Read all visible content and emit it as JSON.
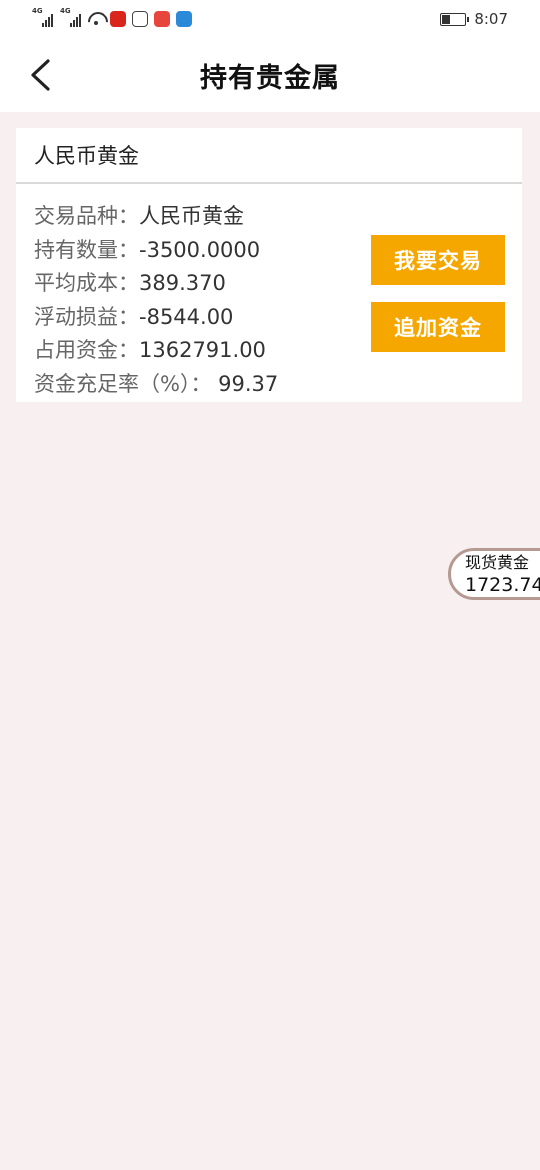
{
  "status_bar": {
    "signal1_tag": "4G",
    "signal2_tag": "4G",
    "time": "8:07",
    "icons": [
      "signal-icon",
      "signal-icon",
      "wifi-icon",
      "app-red-icon",
      "wechat-icon",
      "mail-icon",
      "app-blue-icon",
      "battery-icon"
    ]
  },
  "header": {
    "title": "持有贵金属",
    "back_icon": "chevron-left-icon"
  },
  "holding": {
    "name": "人民币黄金",
    "fields": [
      {
        "label": "交易品种：",
        "value": "人民币黄金"
      },
      {
        "label": "持有数量：",
        "value": "-3500.0000"
      },
      {
        "label": "平均成本：",
        "value": "389.370"
      },
      {
        "label": "浮动损益：",
        "value": "-8544.00"
      },
      {
        "label": "占用资金：",
        "value": "1362791.00"
      },
      {
        "label": "资金充足率（%）：",
        "value": " 99.37"
      }
    ],
    "trade_button": "我要交易",
    "add_funds_button": "追加资金"
  },
  "spot_price": {
    "label": "现货黄金",
    "value": "1723.74"
  },
  "colors": {
    "accent": "#f5a700",
    "background": "#f8f0f0",
    "bubble_border": "#b59a92"
  }
}
